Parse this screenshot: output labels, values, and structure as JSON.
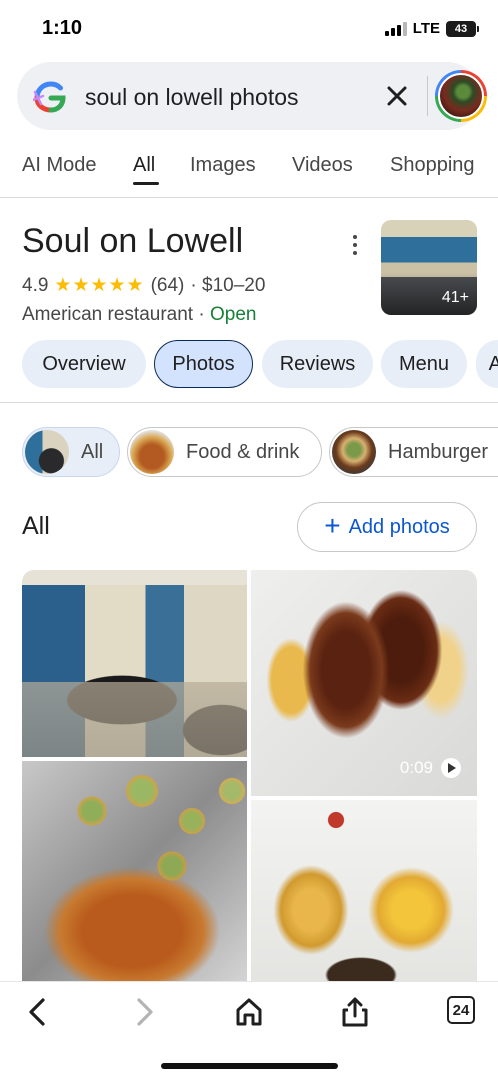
{
  "status_bar": {
    "time": "1:10",
    "network": "LTE",
    "battery": "43"
  },
  "search": {
    "query": "soul on lowell photos",
    "clear_icon": "close-icon",
    "account_icon": "avatar"
  },
  "tabs": [
    {
      "label": "AI Mode",
      "active": false
    },
    {
      "label": "All",
      "active": true
    },
    {
      "label": "Images",
      "active": false
    },
    {
      "label": "Videos",
      "active": false
    },
    {
      "label": "Shopping",
      "active": false
    }
  ],
  "place": {
    "name": "Soul on Lowell",
    "rating": "4.9",
    "stars": "★★★★★",
    "review_count": "(64)",
    "price": "· $10–20",
    "category": "American restaurant ·",
    "status": "Open",
    "thumb_count": "41+"
  },
  "chips": [
    {
      "label": "Overview",
      "selected": false
    },
    {
      "label": "Photos",
      "selected": true
    },
    {
      "label": "Reviews",
      "selected": false
    },
    {
      "label": "Menu",
      "selected": false
    },
    {
      "label": "A",
      "selected": false
    }
  ],
  "filters": [
    {
      "label": "All",
      "active": true
    },
    {
      "label": "Food & drink",
      "active": false
    },
    {
      "label": "Hamburger",
      "active": false
    }
  ],
  "photos_section": {
    "title": "All",
    "add_label": "Add photos"
  },
  "video": {
    "duration": "0:09"
  },
  "bottom_nav": {
    "tabs_count": "24"
  },
  "colors": {
    "accent": "#0b57d0",
    "open": "#188038",
    "star": "#fbbc04",
    "chip_bg": "#e8eef8"
  }
}
